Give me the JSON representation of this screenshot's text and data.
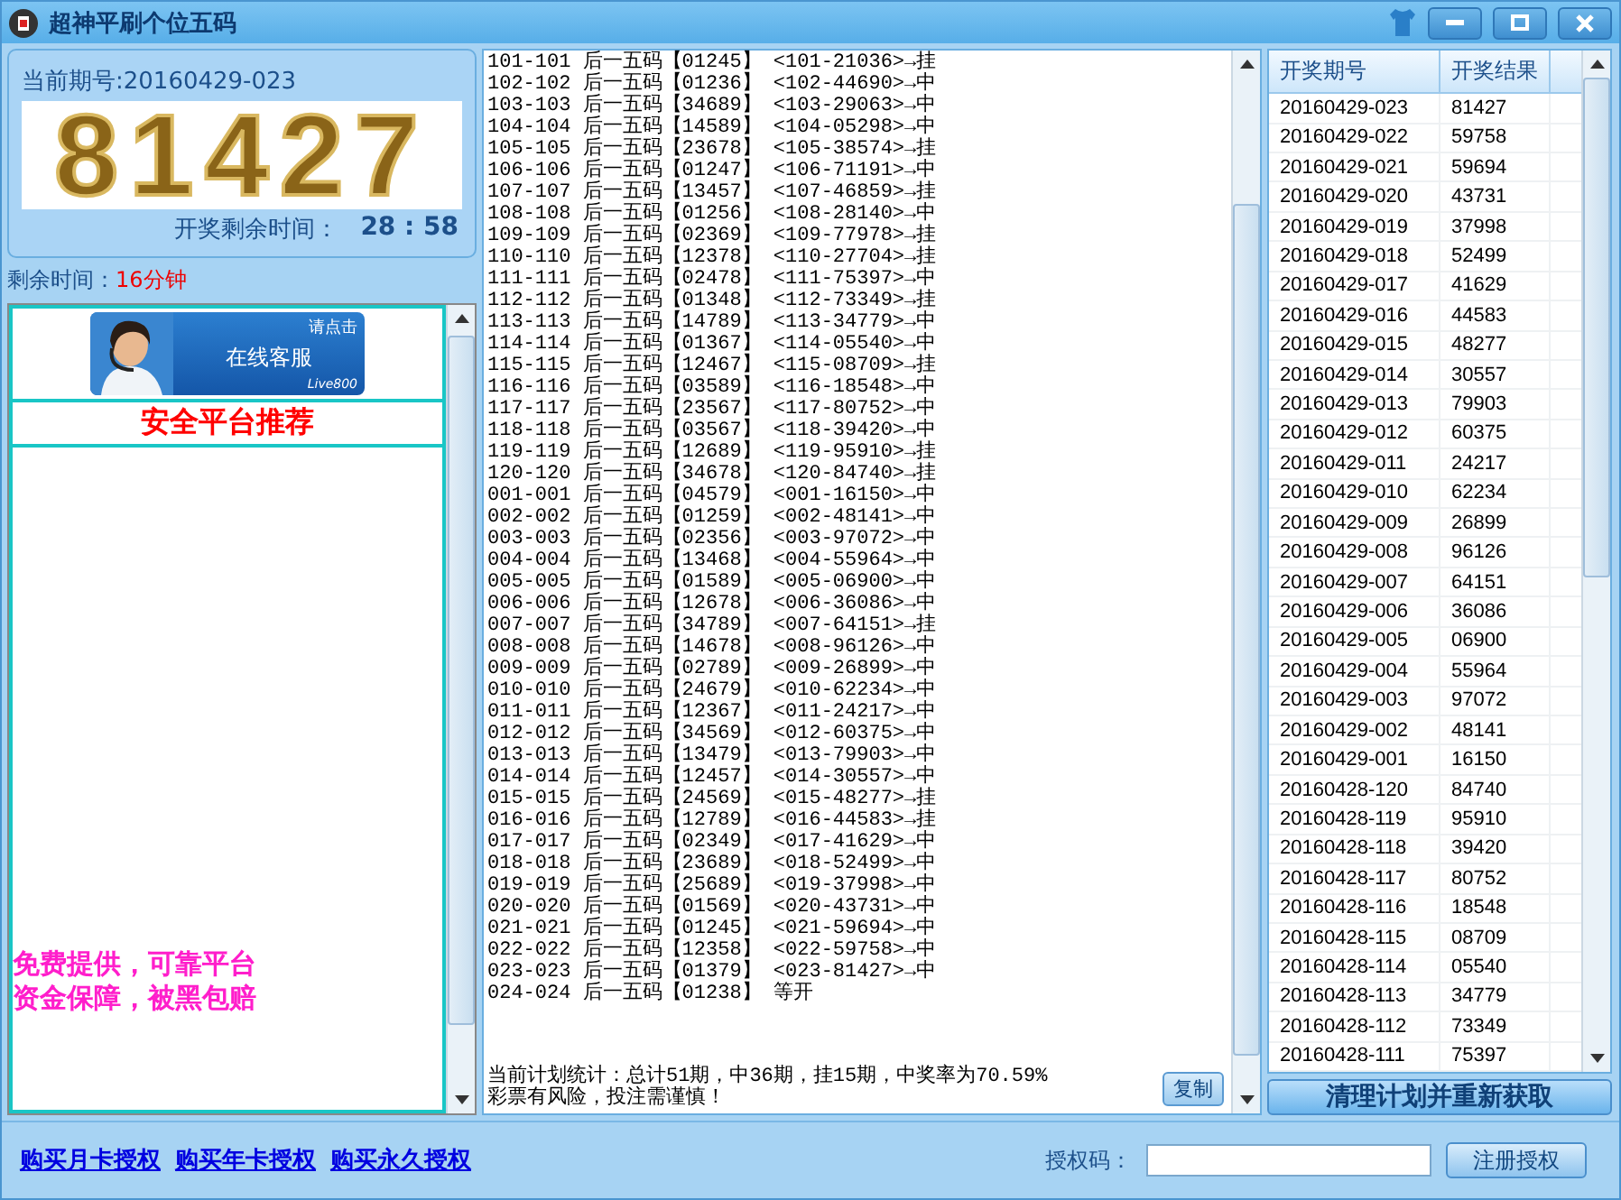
{
  "window": {
    "title": "超神平刷个位五码"
  },
  "current": {
    "period_label": "当前期号:20160429-023",
    "number": "81427",
    "countdown_label": "开奖剩余时间：",
    "countdown": "28 : 58",
    "remaining_label": "剩余时间：",
    "remaining_value": "16分钟"
  },
  "promo": {
    "banner_hint": "请点击",
    "banner_title": "在线客服",
    "banner_brand": "Live800",
    "heading": "安全平台推荐",
    "lines": [
      "免费提供，可靠平台",
      "资金保障，被黑包赔"
    ]
  },
  "plan_lines": [
    "101-101 后一五码【01245】 <101-21036>→挂",
    "102-102 后一五码【01236】 <102-44690>→中",
    "103-103 后一五码【34689】 <103-29063>→中",
    "104-104 后一五码【14589】 <104-05298>→中",
    "105-105 后一五码【23678】 <105-38574>→挂",
    "106-106 后一五码【01247】 <106-71191>→中",
    "107-107 后一五码【13457】 <107-46859>→挂",
    "108-108 后一五码【01256】 <108-28140>→中",
    "109-109 后一五码【02369】 <109-77978>→挂",
    "110-110 后一五码【12378】 <110-27704>→挂",
    "111-111 后一五码【02478】 <111-75397>→中",
    "112-112 后一五码【01348】 <112-73349>→挂",
    "113-113 后一五码【14789】 <113-34779>→中",
    "114-114 后一五码【01367】 <114-05540>→中",
    "115-115 后一五码【12467】 <115-08709>→挂",
    "116-116 后一五码【03589】 <116-18548>→中",
    "117-117 后一五码【23567】 <117-80752>→中",
    "118-118 后一五码【03567】 <118-39420>→中",
    "119-119 后一五码【12689】 <119-95910>→挂",
    "120-120 后一五码【34678】 <120-84740>→挂",
    "001-001 后一五码【04579】 <001-16150>→中",
    "002-002 后一五码【01259】 <002-48141>→中",
    "003-003 后一五码【02356】 <003-97072>→中",
    "004-004 后一五码【13468】 <004-55964>→中",
    "005-005 后一五码【01589】 <005-06900>→中",
    "006-006 后一五码【12678】 <006-36086>→中",
    "007-007 后一五码【34789】 <007-64151>→挂",
    "008-008 后一五码【14678】 <008-96126>→中",
    "009-009 后一五码【02789】 <009-26899>→中",
    "010-010 后一五码【24679】 <010-62234>→中",
    "011-011 后一五码【12367】 <011-24217>→中",
    "012-012 后一五码【34569】 <012-60375>→中",
    "013-013 后一五码【13479】 <013-79903>→中",
    "014-014 后一五码【12457】 <014-30557>→中",
    "015-015 后一五码【24569】 <015-48277>→挂",
    "016-016 后一五码【12789】 <016-44583>→挂",
    "017-017 后一五码【02349】 <017-41629>→中",
    "018-018 后一五码【23689】 <018-52499>→中",
    "019-019 后一五码【25689】 <019-37998>→中",
    "020-020 后一五码【01569】 <020-43731>→中",
    "021-021 后一五码【01245】 <021-59694>→中",
    "022-022 后一五码【12358】 <022-59758>→中",
    "023-023 后一五码【01379】 <023-81427>→中",
    "024-024 后一五码【01238】 等开"
  ],
  "stats": [
    "当前计划统计：总计51期，中36期，挂15期，中奖率为70.59%",
    "彩票有风险，投注需谨慎！"
  ],
  "copy_button": "复制",
  "results": {
    "columns": [
      "开奖期号",
      "开奖结果"
    ],
    "rows": [
      [
        "20160429-023",
        "81427"
      ],
      [
        "20160429-022",
        "59758"
      ],
      [
        "20160429-021",
        "59694"
      ],
      [
        "20160429-020",
        "43731"
      ],
      [
        "20160429-019",
        "37998"
      ],
      [
        "20160429-018",
        "52499"
      ],
      [
        "20160429-017",
        "41629"
      ],
      [
        "20160429-016",
        "44583"
      ],
      [
        "20160429-015",
        "48277"
      ],
      [
        "20160429-014",
        "30557"
      ],
      [
        "20160429-013",
        "79903"
      ],
      [
        "20160429-012",
        "60375"
      ],
      [
        "20160429-011",
        "24217"
      ],
      [
        "20160429-010",
        "62234"
      ],
      [
        "20160429-009",
        "26899"
      ],
      [
        "20160429-008",
        "96126"
      ],
      [
        "20160429-007",
        "64151"
      ],
      [
        "20160429-006",
        "36086"
      ],
      [
        "20160429-005",
        "06900"
      ],
      [
        "20160429-004",
        "55964"
      ],
      [
        "20160429-003",
        "97072"
      ],
      [
        "20160429-002",
        "48141"
      ],
      [
        "20160429-001",
        "16150"
      ],
      [
        "20160428-120",
        "84740"
      ],
      [
        "20160428-119",
        "95910"
      ],
      [
        "20160428-118",
        "39420"
      ],
      [
        "20160428-117",
        "80752"
      ],
      [
        "20160428-116",
        "18548"
      ],
      [
        "20160428-115",
        "08709"
      ],
      [
        "20160428-114",
        "05540"
      ],
      [
        "20160428-113",
        "34779"
      ],
      [
        "20160428-112",
        "73349"
      ],
      [
        "20160428-111",
        "75397"
      ]
    ]
  },
  "clear_button": "清理计划并重新获取",
  "links": [
    "购买月卡授权",
    "购买年卡授权",
    "购买永久授权"
  ],
  "auth": {
    "label": "授权码：",
    "button": "注册授权"
  }
}
